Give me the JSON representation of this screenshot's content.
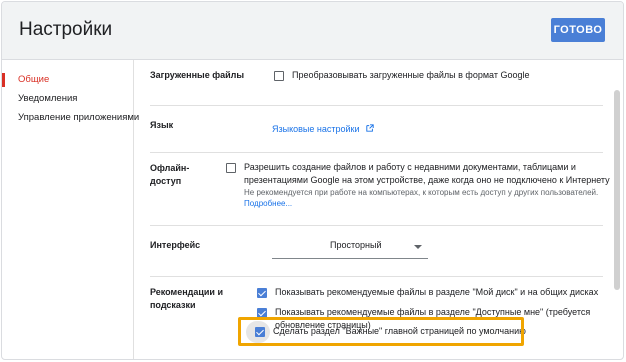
{
  "header": {
    "title": "Настройки",
    "done_label": "ГОТОВО"
  },
  "sidebar": {
    "items": [
      {
        "label": "Общие",
        "active": true
      },
      {
        "label": "Уведомления",
        "active": false
      },
      {
        "label": "Управление приложениями",
        "active": false
      }
    ]
  },
  "settings": {
    "uploads": {
      "label": "Загруженные файлы",
      "option": "Преобразовывать загруженные файлы в формат Google",
      "checked": false
    },
    "language": {
      "label": "Язык",
      "link": "Языковые настройки"
    },
    "offline": {
      "label_line1": "Офлайн-",
      "label_line2": "доступ",
      "option_line1": "Разрешить создание файлов и работу с недавними документами, таблицами и",
      "option_line2": "презентациями Google на этом устройстве, даже когда оно не подключено к Интернету",
      "note": "Не рекомендуется при работе на компьютерах, к которым есть доступ у других пользователей.",
      "more_link": "Подробнее...",
      "checked": false
    },
    "interface": {
      "label": "Интерфейс",
      "value": "Просторный"
    },
    "recommendations": {
      "label_line1": "Рекомендации и",
      "label_line2": "подсказки",
      "options": [
        {
          "text": "Показывать рекомендуемые файлы в разделе \"Мой диск\" и на общих дисках",
          "checked": true
        },
        {
          "text_line1": "Показывать рекомендуемые файлы в разделе \"Доступные мне\" (требуется",
          "text_line2": "обновление страницы)",
          "checked": true
        },
        {
          "text": "Сделать раздел \"Важные\" главной страницей по умолчанию",
          "checked": true
        }
      ]
    }
  },
  "colors": {
    "accent": "#4a7fd6",
    "active": "#d93025",
    "highlight": "#f0a500",
    "link": "#1a73e8"
  }
}
